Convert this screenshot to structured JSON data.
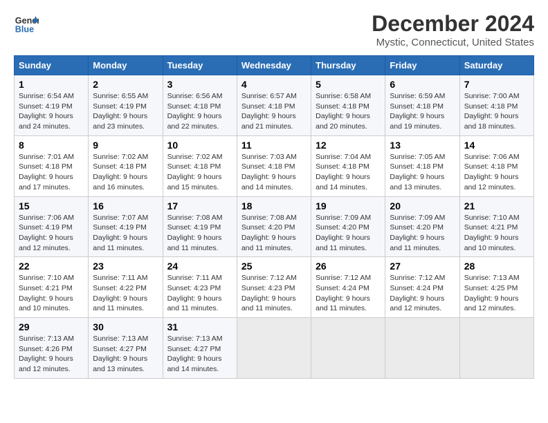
{
  "header": {
    "logo_line1": "General",
    "logo_line2": "Blue",
    "title": "December 2024",
    "subtitle": "Mystic, Connecticut, United States"
  },
  "calendar": {
    "days_of_week": [
      "Sunday",
      "Monday",
      "Tuesday",
      "Wednesday",
      "Thursday",
      "Friday",
      "Saturday"
    ],
    "weeks": [
      [
        {
          "day": "1",
          "sunrise": "6:54 AM",
          "sunset": "4:19 PM",
          "daylight": "9 hours and 24 minutes."
        },
        {
          "day": "2",
          "sunrise": "6:55 AM",
          "sunset": "4:19 PM",
          "daylight": "9 hours and 23 minutes."
        },
        {
          "day": "3",
          "sunrise": "6:56 AM",
          "sunset": "4:18 PM",
          "daylight": "9 hours and 22 minutes."
        },
        {
          "day": "4",
          "sunrise": "6:57 AM",
          "sunset": "4:18 PM",
          "daylight": "9 hours and 21 minutes."
        },
        {
          "day": "5",
          "sunrise": "6:58 AM",
          "sunset": "4:18 PM",
          "daylight": "9 hours and 20 minutes."
        },
        {
          "day": "6",
          "sunrise": "6:59 AM",
          "sunset": "4:18 PM",
          "daylight": "9 hours and 19 minutes."
        },
        {
          "day": "7",
          "sunrise": "7:00 AM",
          "sunset": "4:18 PM",
          "daylight": "9 hours and 18 minutes."
        }
      ],
      [
        {
          "day": "8",
          "sunrise": "7:01 AM",
          "sunset": "4:18 PM",
          "daylight": "9 hours and 17 minutes."
        },
        {
          "day": "9",
          "sunrise": "7:02 AM",
          "sunset": "4:18 PM",
          "daylight": "9 hours and 16 minutes."
        },
        {
          "day": "10",
          "sunrise": "7:02 AM",
          "sunset": "4:18 PM",
          "daylight": "9 hours and 15 minutes."
        },
        {
          "day": "11",
          "sunrise": "7:03 AM",
          "sunset": "4:18 PM",
          "daylight": "9 hours and 14 minutes."
        },
        {
          "day": "12",
          "sunrise": "7:04 AM",
          "sunset": "4:18 PM",
          "daylight": "9 hours and 14 minutes."
        },
        {
          "day": "13",
          "sunrise": "7:05 AM",
          "sunset": "4:18 PM",
          "daylight": "9 hours and 13 minutes."
        },
        {
          "day": "14",
          "sunrise": "7:06 AM",
          "sunset": "4:18 PM",
          "daylight": "9 hours and 12 minutes."
        }
      ],
      [
        {
          "day": "15",
          "sunrise": "7:06 AM",
          "sunset": "4:19 PM",
          "daylight": "9 hours and 12 minutes."
        },
        {
          "day": "16",
          "sunrise": "7:07 AM",
          "sunset": "4:19 PM",
          "daylight": "9 hours and 11 minutes."
        },
        {
          "day": "17",
          "sunrise": "7:08 AM",
          "sunset": "4:19 PM",
          "daylight": "9 hours and 11 minutes."
        },
        {
          "day": "18",
          "sunrise": "7:08 AM",
          "sunset": "4:20 PM",
          "daylight": "9 hours and 11 minutes."
        },
        {
          "day": "19",
          "sunrise": "7:09 AM",
          "sunset": "4:20 PM",
          "daylight": "9 hours and 11 minutes."
        },
        {
          "day": "20",
          "sunrise": "7:09 AM",
          "sunset": "4:20 PM",
          "daylight": "9 hours and 11 minutes."
        },
        {
          "day": "21",
          "sunrise": "7:10 AM",
          "sunset": "4:21 PM",
          "daylight": "9 hours and 10 minutes."
        }
      ],
      [
        {
          "day": "22",
          "sunrise": "7:10 AM",
          "sunset": "4:21 PM",
          "daylight": "9 hours and 10 minutes."
        },
        {
          "day": "23",
          "sunrise": "7:11 AM",
          "sunset": "4:22 PM",
          "daylight": "9 hours and 11 minutes."
        },
        {
          "day": "24",
          "sunrise": "7:11 AM",
          "sunset": "4:23 PM",
          "daylight": "9 hours and 11 minutes."
        },
        {
          "day": "25",
          "sunrise": "7:12 AM",
          "sunset": "4:23 PM",
          "daylight": "9 hours and 11 minutes."
        },
        {
          "day": "26",
          "sunrise": "7:12 AM",
          "sunset": "4:24 PM",
          "daylight": "9 hours and 11 minutes."
        },
        {
          "day": "27",
          "sunrise": "7:12 AM",
          "sunset": "4:24 PM",
          "daylight": "9 hours and 12 minutes."
        },
        {
          "day": "28",
          "sunrise": "7:13 AM",
          "sunset": "4:25 PM",
          "daylight": "9 hours and 12 minutes."
        }
      ],
      [
        {
          "day": "29",
          "sunrise": "7:13 AM",
          "sunset": "4:26 PM",
          "daylight": "9 hours and 12 minutes."
        },
        {
          "day": "30",
          "sunrise": "7:13 AM",
          "sunset": "4:27 PM",
          "daylight": "9 hours and 13 minutes."
        },
        {
          "day": "31",
          "sunrise": "7:13 AM",
          "sunset": "4:27 PM",
          "daylight": "9 hours and 14 minutes."
        },
        null,
        null,
        null,
        null
      ]
    ]
  },
  "labels": {
    "sunrise": "Sunrise:",
    "sunset": "Sunset:",
    "daylight": "Daylight:"
  }
}
